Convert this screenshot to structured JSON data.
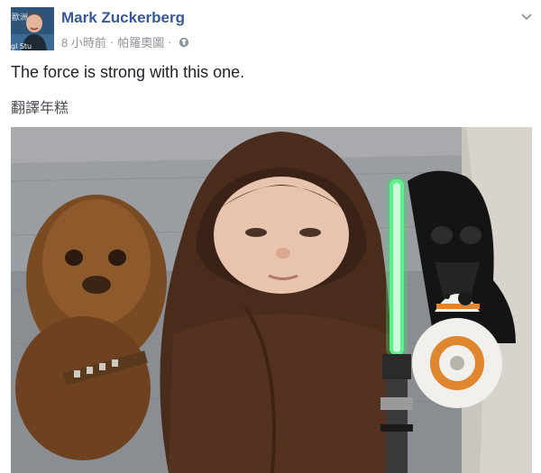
{
  "post": {
    "author_name": "Mark Zuckerberg",
    "timestamp": "8 小時前",
    "location": "帕羅奧圖",
    "separator": "·",
    "privacy_icon": "globe-icon",
    "options_icon": "chevron-down-icon",
    "text": "The force is strong with this one.",
    "translate_label": "翻譯年糕",
    "photo_icon": "baby-jedi-photo"
  },
  "avatar": {
    "badge_text_top": "歐洲",
    "badge_text_bottom": "gl Stu"
  },
  "colors": {
    "author_link": "#365899",
    "meta_text": "#90949c",
    "lightsaber": "#39e06e"
  }
}
